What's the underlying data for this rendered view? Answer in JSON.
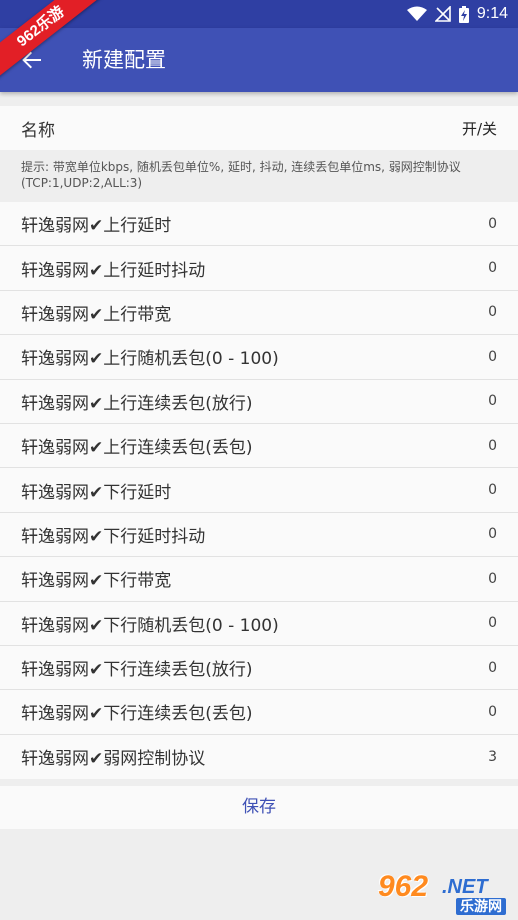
{
  "status_bar": {
    "time": "9:14",
    "icons": [
      "wifi-icon",
      "signal-off-icon",
      "battery-charging-icon"
    ]
  },
  "corner_ribbon": "962乐游",
  "app_bar": {
    "title": "新建配置",
    "back_icon": "arrow-left-icon",
    "color": "#3f51b5"
  },
  "header": {
    "name_label": "名称",
    "toggle_label": "开/关"
  },
  "hint": "提示: 带宽单位kbps, 随机丢包单位%, 延时, 抖动, 连续丢包单位ms, 弱网控制协议(TCP:1,UDP:2,ALL:3)",
  "rows": [
    {
      "label": "轩逸弱网✔上行延时",
      "value": "0"
    },
    {
      "label": "轩逸弱网✔上行延时抖动",
      "value": "0"
    },
    {
      "label": "轩逸弱网✔上行带宽",
      "value": "0"
    },
    {
      "label": "轩逸弱网✔上行随机丢包(0 - 100)",
      "value": "0"
    },
    {
      "label": "轩逸弱网✔上行连续丢包(放行)",
      "value": "0"
    },
    {
      "label": "轩逸弱网✔上行连续丢包(丢包)",
      "value": "0"
    },
    {
      "label": "轩逸弱网✔下行延时",
      "value": "0"
    },
    {
      "label": "轩逸弱网✔下行延时抖动",
      "value": "0"
    },
    {
      "label": "轩逸弱网✔下行带宽",
      "value": "0"
    },
    {
      "label": "轩逸弱网✔下行随机丢包(0 - 100)",
      "value": "0"
    },
    {
      "label": "轩逸弱网✔下行连续丢包(放行)",
      "value": "0"
    },
    {
      "label": "轩逸弱网✔下行连续丢包(丢包)",
      "value": "0"
    },
    {
      "label": "轩逸弱网✔弱网控制协议",
      "value": "3"
    }
  ],
  "save_label": "保存",
  "watermark": {
    "number": "962",
    "domain": ".NET",
    "sub": "乐游网"
  }
}
